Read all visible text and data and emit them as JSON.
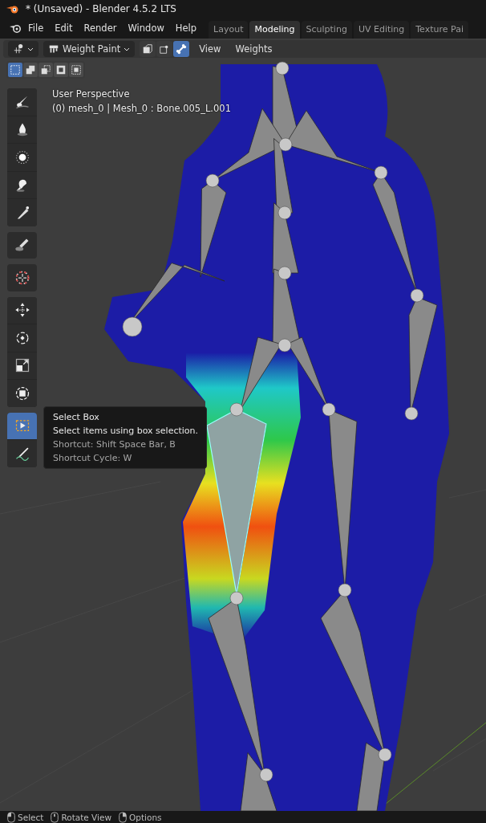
{
  "window": {
    "title": "* (Unsaved) - Blender 4.5.2 LTS"
  },
  "menu": [
    "File",
    "Edit",
    "Render",
    "Window",
    "Help"
  ],
  "workspace_tabs": [
    {
      "label": "Layout",
      "selected": false
    },
    {
      "label": "Modeling",
      "selected": true
    },
    {
      "label": "Sculpting",
      "selected": false
    },
    {
      "label": "UV Editing",
      "selected": false
    },
    {
      "label": "Texture Pai",
      "selected": false
    }
  ],
  "header": {
    "mode": "Weight Paint",
    "mask_toggles": [
      {
        "kind": "face",
        "selected": false
      },
      {
        "kind": "vertex",
        "selected": false
      },
      {
        "kind": "bone",
        "selected": true
      }
    ],
    "menus": [
      "View",
      "Weights"
    ]
  },
  "select_modes": [
    {
      "kind": "new",
      "selected": true
    },
    {
      "kind": "extend",
      "selected": false
    },
    {
      "kind": "subtract",
      "selected": false
    },
    {
      "kind": "invert",
      "selected": false
    },
    {
      "kind": "intersect",
      "selected": false
    }
  ],
  "viewport": {
    "view_name": "User Perspective",
    "object_info": "(0) mesh_0 | Mesh_0 : Bone.005_L.001"
  },
  "toolbar": [
    [
      {
        "kind": "draw",
        "selected": false
      },
      {
        "kind": "blur",
        "selected": false
      },
      {
        "kind": "average",
        "selected": false
      },
      {
        "kind": "smear",
        "selected": false
      },
      {
        "kind": "gradient",
        "selected": false
      }
    ],
    [
      {
        "kind": "sample",
        "selected": false
      }
    ],
    [
      {
        "kind": "cursor",
        "selected": false
      }
    ],
    [
      {
        "kind": "move",
        "selected": false
      },
      {
        "kind": "rotate",
        "selected": false
      },
      {
        "kind": "scale",
        "selected": false
      },
      {
        "kind": "transform",
        "selected": false
      }
    ],
    [
      {
        "kind": "select_box",
        "selected": true
      },
      {
        "kind": "annotate",
        "selected": false
      }
    ]
  ],
  "tooltip": {
    "title": "Select Box",
    "description": "Select items using box selection.",
    "shortcut": "Shortcut: Shift Space Bar, B",
    "shortcut_cycle": "Shortcut Cycle: W"
  },
  "status_bar": [
    {
      "kind": "left",
      "label": "Select"
    },
    {
      "kind": "middle",
      "label": "Rotate View"
    },
    {
      "kind": "right",
      "label": "Options"
    }
  ]
}
